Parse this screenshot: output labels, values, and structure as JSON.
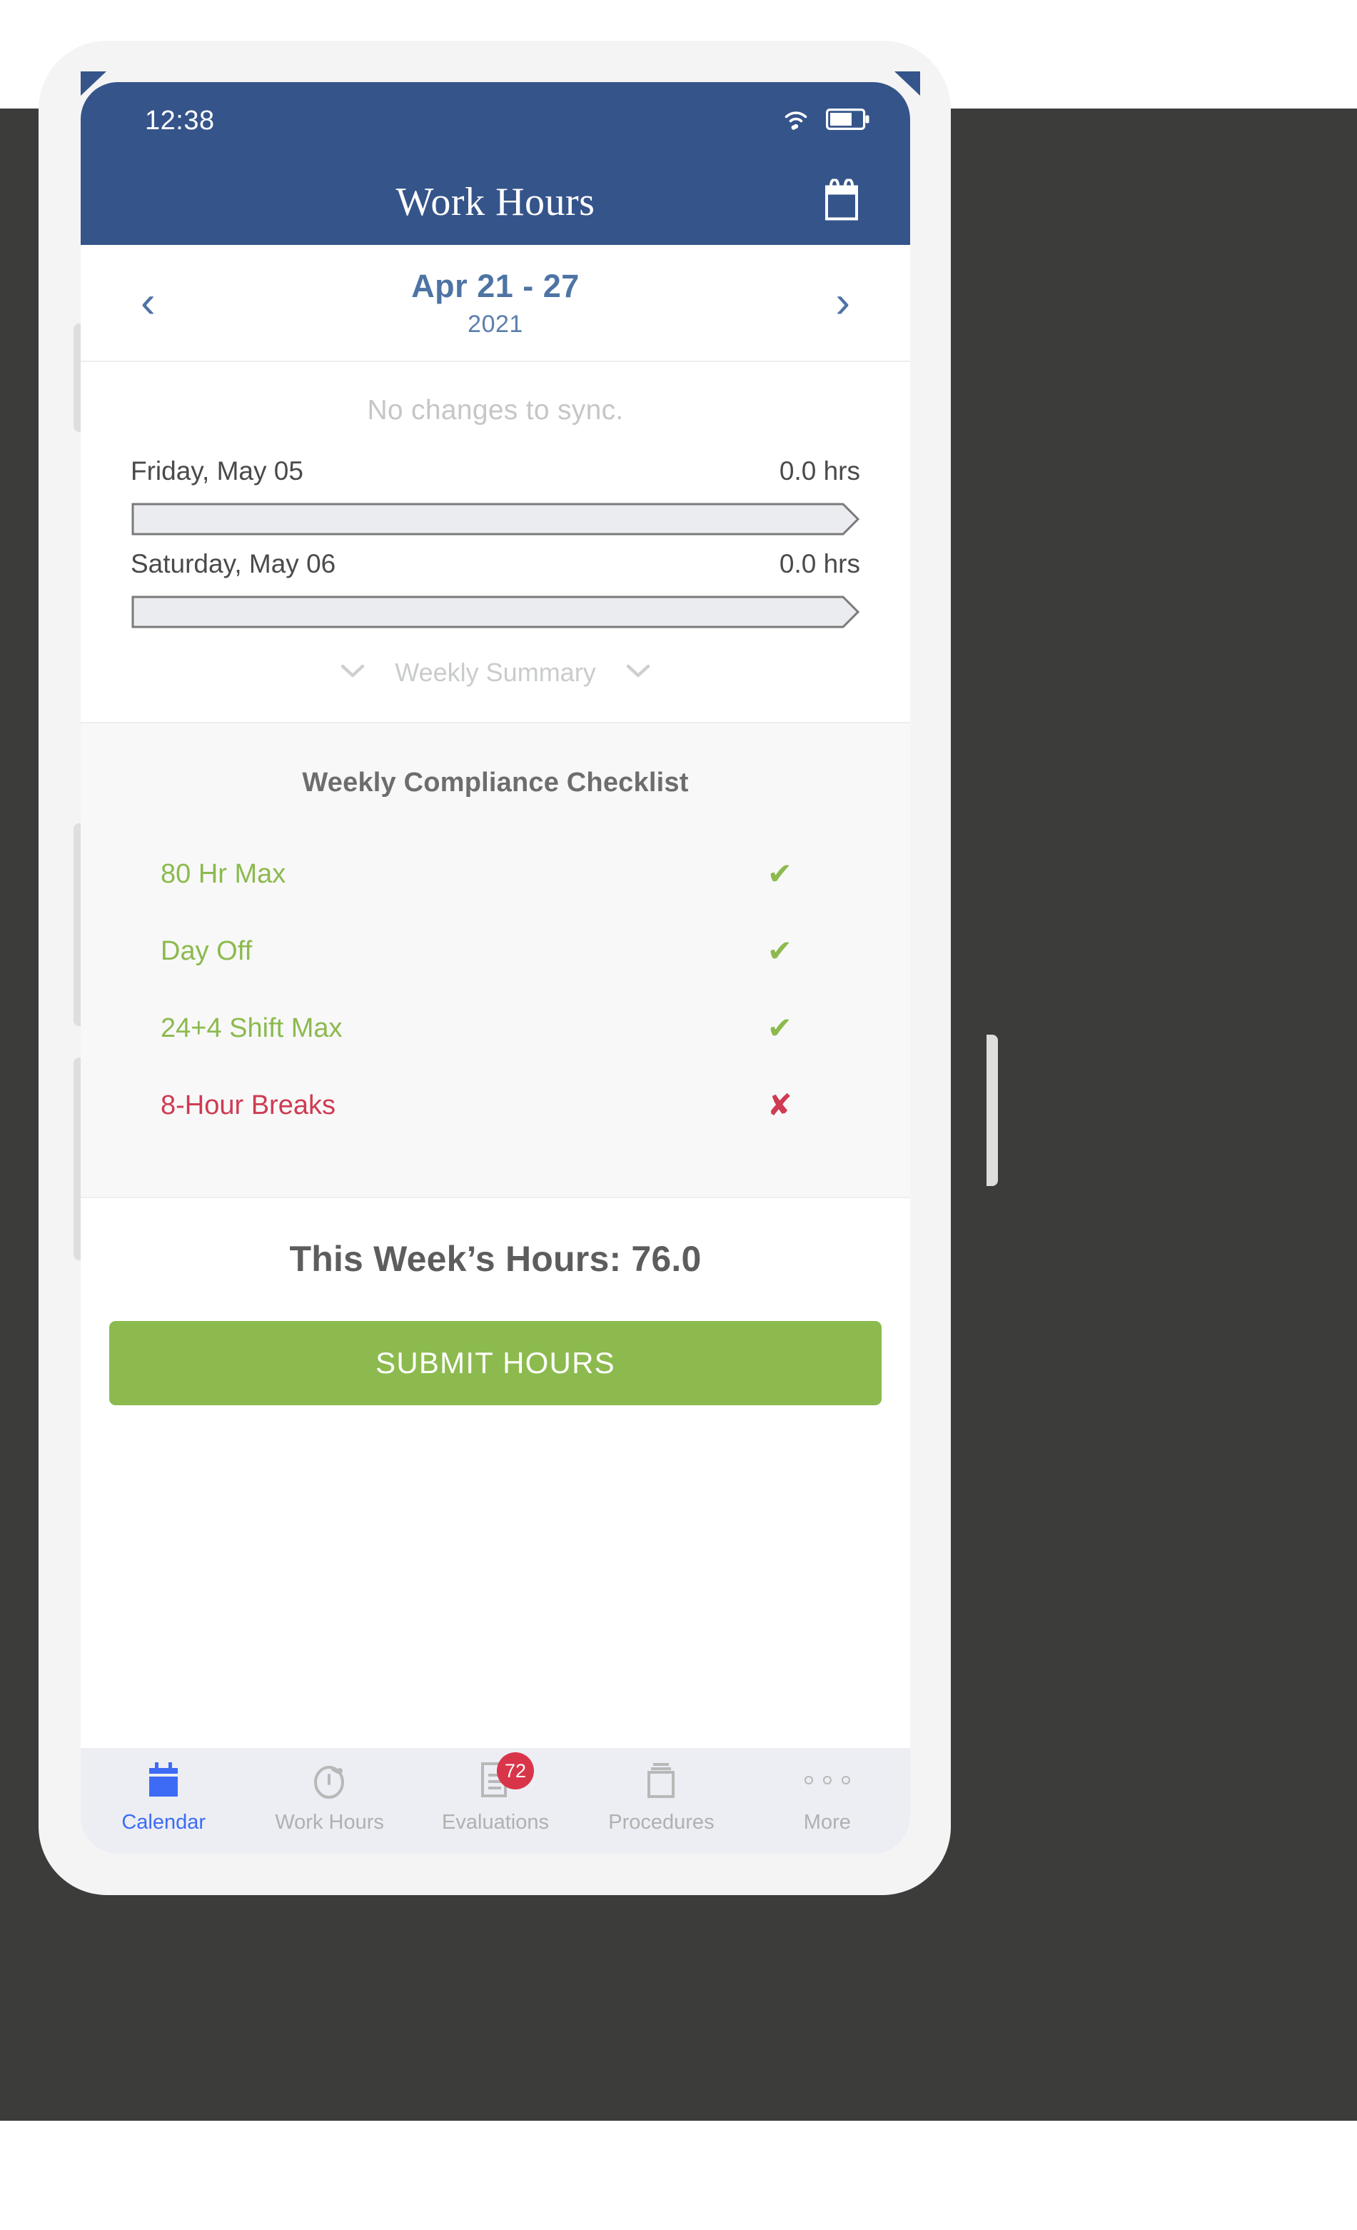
{
  "statusbar": {
    "time": "12:38",
    "wifi_icon": "wifi-icon",
    "battery_icon": "battery-icon"
  },
  "appbar": {
    "title": "Work Hours",
    "action_icon": "calendar-icon"
  },
  "weeknav": {
    "prev_icon": "chevron-left-icon",
    "next_icon": "chevron-right-icon",
    "range": "Apr 21 - 27",
    "year": "2021"
  },
  "days_panel": {
    "sync_message": "No changes to sync.",
    "days": [
      {
        "label": "Friday, May 05",
        "hours": "0.0 hrs",
        "fill_percent": 0
      },
      {
        "label": "Saturday, May 06",
        "hours": "0.0 hrs",
        "fill_percent": 0
      }
    ],
    "summary": {
      "label": "Weekly Summary",
      "left_icon": "chevron-down-icon",
      "right_icon": "chevron-down-icon"
    }
  },
  "compliance": {
    "title": "Weekly Compliance Checklist",
    "pass_color": "#8cba4e",
    "fail_color": "#cf3b52",
    "items": [
      {
        "label": "80 Hr Max",
        "status": "pass",
        "mark": "✔",
        "icon": "check-icon"
      },
      {
        "label": "Day Off",
        "status": "pass",
        "mark": "✔",
        "icon": "check-icon"
      },
      {
        "label": "24+4 Shift Max",
        "status": "pass",
        "mark": "✔",
        "icon": "check-icon"
      },
      {
        "label": "8-Hour Breaks",
        "status": "fail",
        "mark": "✘",
        "icon": "cross-icon"
      }
    ]
  },
  "totals": {
    "title": "This Week’s Hours: 76.0",
    "submit_label": "SUBMIT HOURS",
    "submit_color": "#8cba4e"
  },
  "tabbar": {
    "active_color": "#3d6bf5",
    "inactive_color": "#b0b0b0",
    "badge_color": "#d9354a",
    "tabs": [
      {
        "label": "Calendar",
        "icon": "calendar-icon",
        "active": true,
        "badge": null
      },
      {
        "label": "Work Hours",
        "icon": "stopwatch-icon",
        "active": false,
        "badge": null
      },
      {
        "label": "Evaluations",
        "icon": "document-icon",
        "active": false,
        "badge": "72"
      },
      {
        "label": "Procedures",
        "icon": "documents-stack-icon",
        "active": false,
        "badge": null
      },
      {
        "label": "More",
        "icon": "ellipsis-icon",
        "active": false,
        "badge": null
      }
    ]
  },
  "theme": {
    "header_blue": "#35548a",
    "accent_blue": "#4d74a4",
    "panel_grey": "#f8f8f8",
    "backdrop": "#3c3c3b"
  }
}
